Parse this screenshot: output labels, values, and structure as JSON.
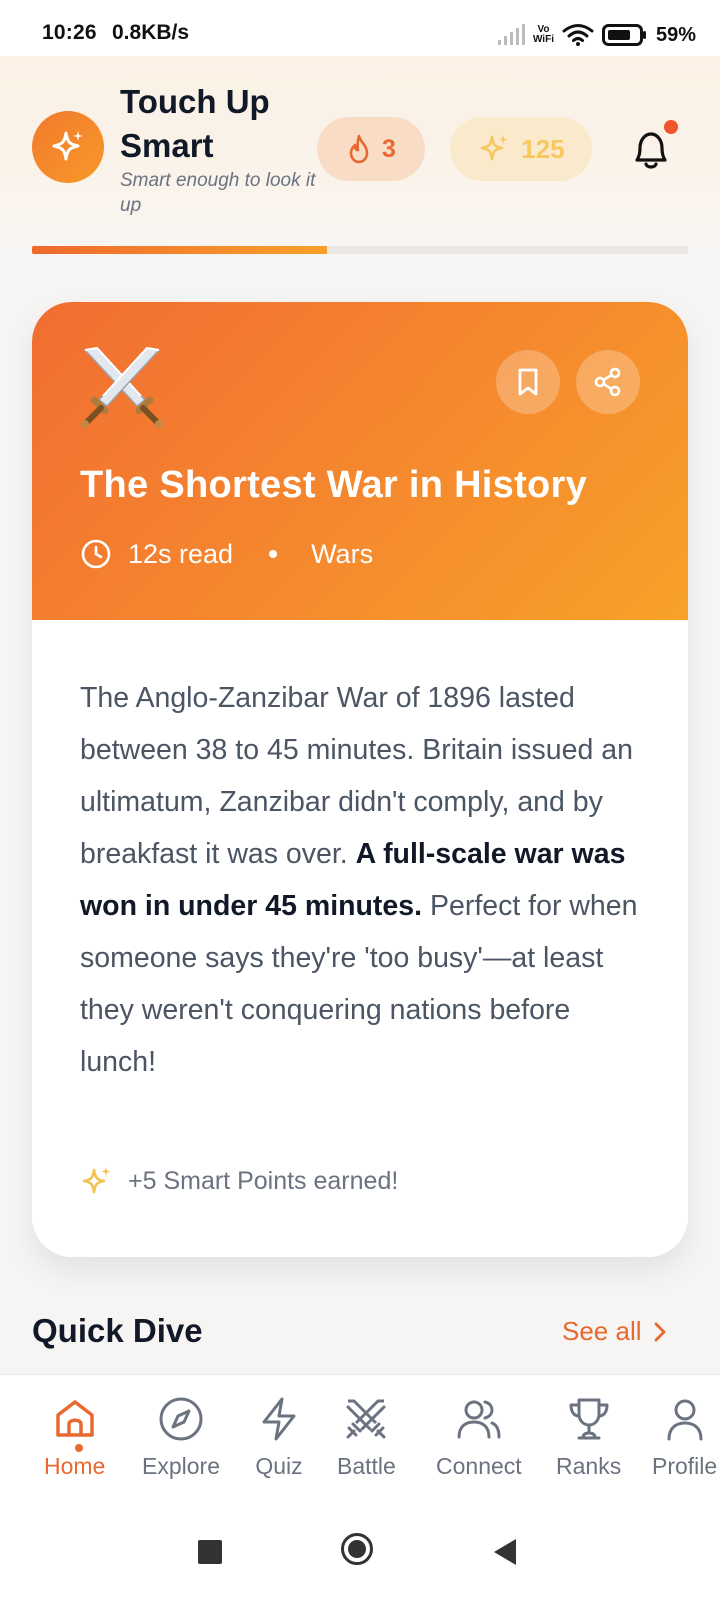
{
  "status_bar": {
    "time": "10:26",
    "speed": "0.8KB/s",
    "vowifi_top": "Vo",
    "vowifi_bottom": "WiFi",
    "battery": "59%"
  },
  "header": {
    "title": "Touch Up Smart",
    "tagline": "Smart enough to look it up",
    "streak": "3",
    "points": "125",
    "icons": {
      "logo": "sparkle-icon",
      "streak": "flame-icon",
      "points": "sparkle-icon",
      "notifications": "bell-icon"
    }
  },
  "progress": {
    "fraction": 0.45,
    "color": "#f0692d"
  },
  "card": {
    "emoji": "⚔️",
    "title": "The Shortest War in History",
    "read_time": "12s read",
    "category": "Wars",
    "body_intro": "The Anglo-Zanzibar War of 1896 lasted between 38 to 45 minutes. Britain issued an ultimatum, Zanzibar didn't comply, and by breakfast it was over.",
    "body_bold": "A full-scale war was won in under 45 minutes.",
    "body_outro": "Perfect for when someone says they're 'too busy'—at least they weren't conquering nations before lunch!",
    "earned": "+5 Smart Points earned!",
    "icons": {
      "bookmark": "bookmark-icon",
      "share": "share-icon",
      "clock": "clock-icon"
    }
  },
  "quick_dive": {
    "title": "Quick Dive",
    "see_all": "See all"
  },
  "nav": [
    {
      "label": "Home",
      "icon": "home-icon",
      "active": true
    },
    {
      "label": "Explore",
      "icon": "compass-icon"
    },
    {
      "label": "Quiz",
      "icon": "lightning-icon"
    },
    {
      "label": "Battle",
      "icon": "swords-icon"
    },
    {
      "label": "Connect",
      "icon": "users-icon"
    },
    {
      "label": "Ranks",
      "icon": "trophy-icon"
    },
    {
      "label": "Profile",
      "icon": "user-icon"
    }
  ],
  "colors": {
    "accent": "#e8692f",
    "gold": "#f6c85f",
    "hero_start": "#f16d31",
    "hero_end": "#f8a128"
  }
}
